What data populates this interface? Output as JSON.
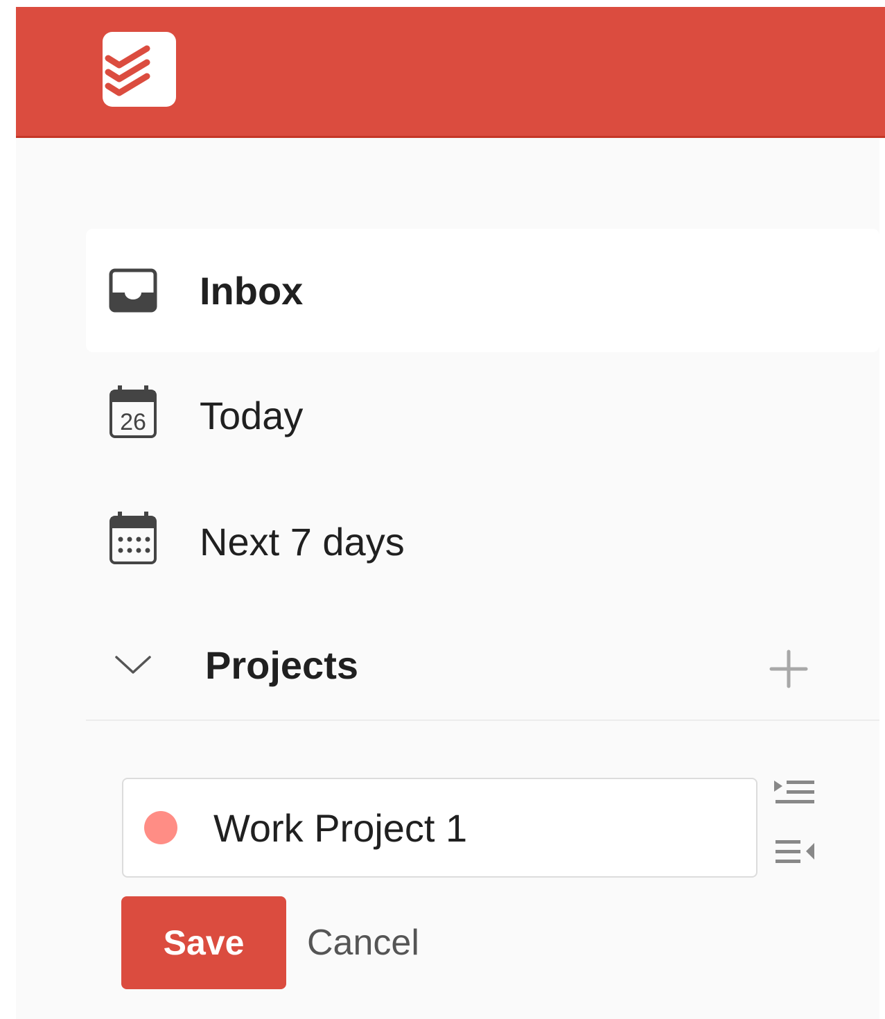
{
  "app": {
    "logo_icon": "todoist-logo-icon",
    "brand_color": "#db4c3f"
  },
  "nav": {
    "items": [
      {
        "label": "Inbox",
        "icon": "inbox-icon",
        "active": true
      },
      {
        "label": "Today",
        "icon": "calendar-today-icon",
        "day_number": "26",
        "active": false
      },
      {
        "label": "Next 7 days",
        "icon": "calendar-week-icon",
        "active": false
      }
    ]
  },
  "projects": {
    "title": "Projects",
    "collapse_icon": "chevron-down-icon",
    "add_icon": "plus-icon"
  },
  "editor": {
    "value": "Work Project 1",
    "color_dot": "#ff8d85",
    "indent_icon": "indent-icon",
    "outdent_icon": "outdent-icon",
    "save_label": "Save",
    "cancel_label": "Cancel"
  }
}
